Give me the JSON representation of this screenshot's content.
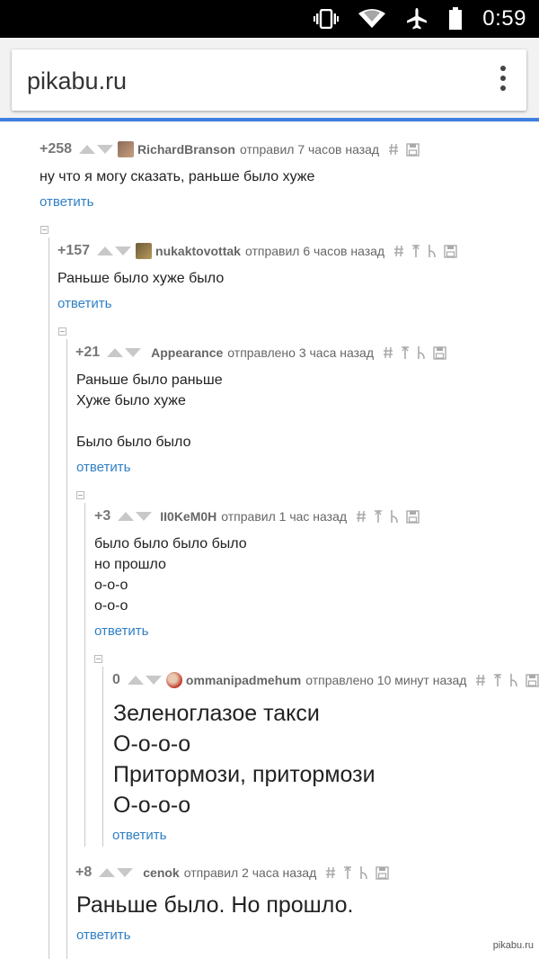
{
  "status_bar": {
    "time": "0:59",
    "icons": [
      "vibrate-icon",
      "wifi-icon",
      "airplane-icon",
      "battery-icon"
    ]
  },
  "browser": {
    "url": "pikabu.ru",
    "menu_icon": "overflow-menu-icon",
    "accent": "#3f7fe0"
  },
  "comments": [
    {
      "rating": "+258",
      "author": "RichardBranson",
      "sent": "отправил 7 часов назад",
      "text": "ну что я могу сказать, раньше было хуже",
      "reply": "ответить"
    },
    {
      "rating": "+157",
      "author": "nukaktovottak",
      "sent": "отправил 6 часов назад",
      "text": "Раньше было хуже было",
      "reply": "ответить"
    },
    {
      "rating": "+21",
      "author": "Appearance",
      "sent": "отправлено 3 часа назад",
      "text": "Раньше было раньше\nХуже было хуже\n\nБыло было было",
      "reply": "ответить"
    },
    {
      "rating": "+3",
      "author": "II0KeM0H",
      "sent": "отправил 1 час назад",
      "text": "было было было было\nно прошло\nо-о-о\nо-о-о",
      "reply": "ответить"
    },
    {
      "rating": "0",
      "author": "ommanipadmehum",
      "sent": "отправлено 10 минут назад",
      "text": "Зеленоглазое такси\nО-о-о-о\nПритормози, притормози\nО-о-о-о",
      "reply": "ответить"
    },
    {
      "rating": "+8",
      "author": "cenok",
      "sent": "отправил 2 часа назад",
      "text": "Раньше было. Но прошло.",
      "reply": "ответить"
    }
  ],
  "colors": {
    "link": "#2f7fc3",
    "meta_text": "#666666",
    "vote_arrow": "#c8c8c8"
  },
  "watermark": "pikabu.ru"
}
